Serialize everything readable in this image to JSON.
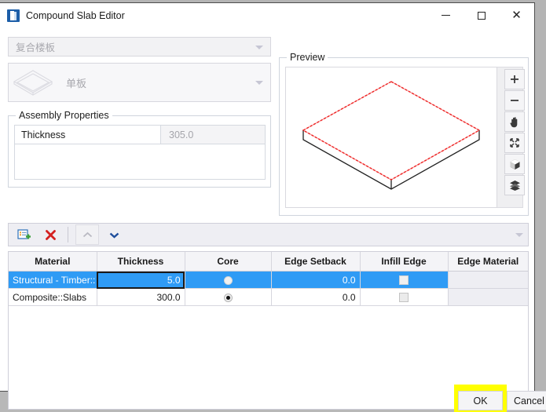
{
  "window": {
    "title": "Compound Slab Editor",
    "app_icon": "slab-app-icon",
    "minimize_label": "",
    "maximize_label": "",
    "close_label": "✕"
  },
  "selectors": {
    "assembly_type": {
      "value": "复合楼板",
      "icon": "chevron-down-icon"
    },
    "layer_type": {
      "value": "单板",
      "icon": "chevron-down-icon",
      "thumb": "slab-diamond-icon"
    }
  },
  "assembly_properties": {
    "group_title": "Assembly Properties",
    "rows": [
      {
        "name": "Thickness",
        "value": "305.0"
      }
    ]
  },
  "preview": {
    "group_title": "Preview",
    "tools": [
      {
        "name": "zoom-in-icon",
        "label": "+"
      },
      {
        "name": "zoom-out-icon",
        "label": "−"
      },
      {
        "name": "pan-hand-icon",
        "label": ""
      },
      {
        "name": "fit-to-view-icon",
        "label": ""
      },
      {
        "name": "orbit-3d-cube-icon",
        "label": ""
      },
      {
        "name": "layers-icon",
        "label": ""
      }
    ]
  },
  "table_toolbar": {
    "buttons": [
      {
        "name": "insert-row-icon",
        "label": ""
      },
      {
        "name": "delete-row-icon",
        "label": ""
      },
      {
        "name": "move-up-icon",
        "label": ""
      },
      {
        "name": "move-down-icon",
        "label": ""
      }
    ],
    "overflow": "toolbar-overflow-icon"
  },
  "layers_table": {
    "columns": [
      "Material",
      "Thickness",
      "Core",
      "Edge Setback",
      "Infill Edge",
      "Edge Material"
    ],
    "rows": [
      {
        "selected": true,
        "material": "Structural - Timber::",
        "thickness": "5.0",
        "core": false,
        "edge_setback": "0.0",
        "infill_edge": false,
        "edge_material": ""
      },
      {
        "selected": false,
        "material": "Composite::Slabs",
        "thickness": "300.0",
        "core": true,
        "edge_setback": "0.0",
        "infill_edge": false,
        "edge_material": ""
      }
    ]
  },
  "footer": {
    "ok_label": "OK",
    "cancel_label": "Cancel"
  },
  "colors": {
    "selection_blue": "#2f9bf5",
    "highlight_yellow": "#ffff00",
    "preview_edge_red": "#ee2222",
    "title_bar": "#ffffff"
  }
}
